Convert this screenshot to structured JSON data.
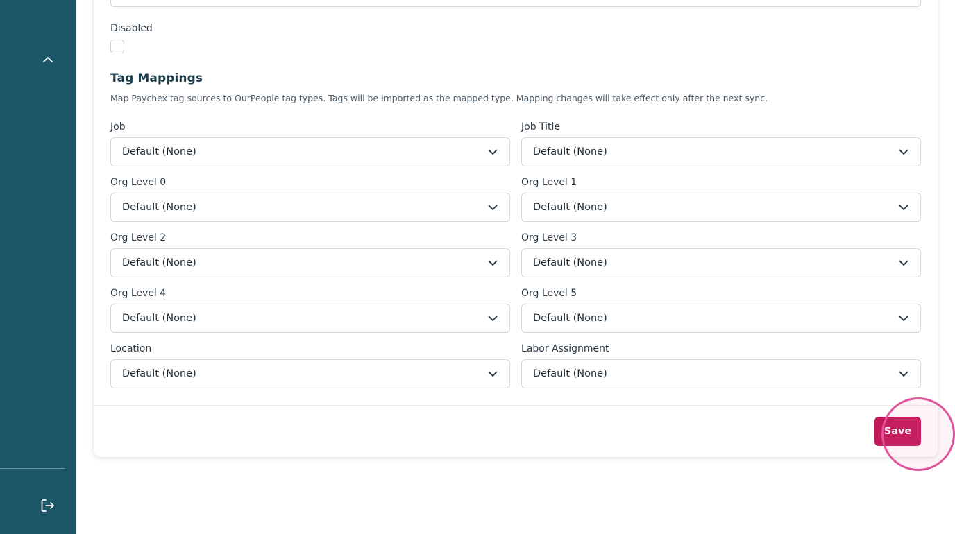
{
  "sidebar": {
    "collapse_icon": "chevron-up-icon",
    "logout_icon": "logout-icon",
    "background_color": "#1b5766"
  },
  "form": {
    "disabled_label": "Disabled",
    "disabled_checked": false
  },
  "tag_mappings": {
    "title": "Tag Mappings",
    "description": "Map Paychex tag sources to OurPeople tag types. Tags will be imported as the mapped type. Mapping changes will take effect only after the next sync.",
    "fields": [
      {
        "label": "Job",
        "value": "Default (None)"
      },
      {
        "label": "Job Title",
        "value": "Default (None)"
      },
      {
        "label": "Org Level 0",
        "value": "Default (None)"
      },
      {
        "label": "Org Level 1",
        "value": "Default (None)"
      },
      {
        "label": "Org Level 2",
        "value": "Default (None)"
      },
      {
        "label": "Org Level 3",
        "value": "Default (None)"
      },
      {
        "label": "Org Level 4",
        "value": "Default (None)"
      },
      {
        "label": "Org Level 5",
        "value": "Default (None)"
      },
      {
        "label": "Location",
        "value": "Default (None)"
      },
      {
        "label": "Labor Assignment",
        "value": "Default (None)"
      }
    ]
  },
  "footer": {
    "save_label": "Save",
    "save_color": "#c2185b"
  }
}
